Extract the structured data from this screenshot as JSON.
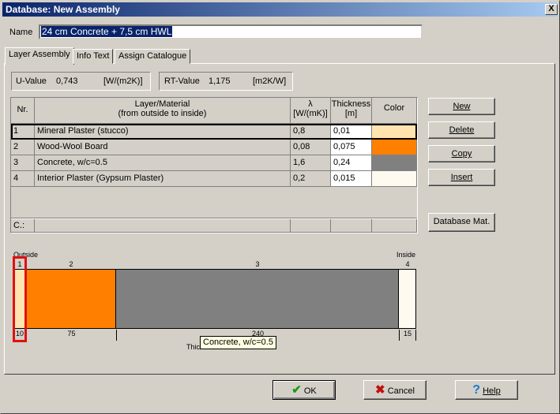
{
  "window": {
    "title": "Database: New Assembly",
    "close": "X"
  },
  "name": {
    "label": "Name",
    "value": "24 cm Concrete + 7,5 cm HWL"
  },
  "tabs": [
    {
      "label": "Layer Assembly"
    },
    {
      "label": "Info Text"
    },
    {
      "label": "Assign Catalogue"
    }
  ],
  "u_value": {
    "label": "U-Value",
    "value": "0,743",
    "unit": "[W/(m2K)]"
  },
  "rt_value": {
    "label": "RT-Value",
    "value": "1,175",
    "unit": "[m2K/W]"
  },
  "table": {
    "headers": {
      "nr": "Nr.",
      "material": "Layer/Material",
      "material_sub": "(from outside to inside)",
      "lambda": "λ",
      "lambda_unit": "[W/(mK)]",
      "thickness": "Thickness",
      "thickness_unit": "[m]",
      "color": "Color"
    },
    "rows": [
      {
        "nr": "1",
        "material": "Mineral Plaster (stucco)",
        "lambda": "0,8",
        "thickness": "0,01",
        "color": "#ffe4b0"
      },
      {
        "nr": "2",
        "material": "Wood-Wool Board",
        "lambda": "0,08",
        "thickness": "0,075",
        "color": "#ff8000"
      },
      {
        "nr": "3",
        "material": "Concrete, w/c=0.5",
        "lambda": "1,6",
        "thickness": "0,24",
        "color": "#808080"
      },
      {
        "nr": "4",
        "material": "Interior Plaster (Gypsum Plaster)",
        "lambda": "0,2",
        "thickness": "0,015",
        "color": "#fffaf0"
      }
    ],
    "footer": "C.:"
  },
  "side_buttons": {
    "new": "New",
    "delete": "Delete",
    "copy": "Copy",
    "insert": "Insert",
    "database": "Database Mat."
  },
  "diagram": {
    "outside": "Outside",
    "inside": "Inside",
    "layers": [
      {
        "nr": "1",
        "mm": "10"
      },
      {
        "nr": "2",
        "mm": "75"
      },
      {
        "nr": "3",
        "mm": "240"
      },
      {
        "nr": "4",
        "mm": "15"
      }
    ],
    "axis_label_partial": "Thic",
    "tooltip": "Concrete, w/c=0.5",
    "selected_layer": "1"
  },
  "buttons": {
    "ok": "OK",
    "cancel": "Cancel",
    "help": "Help"
  }
}
